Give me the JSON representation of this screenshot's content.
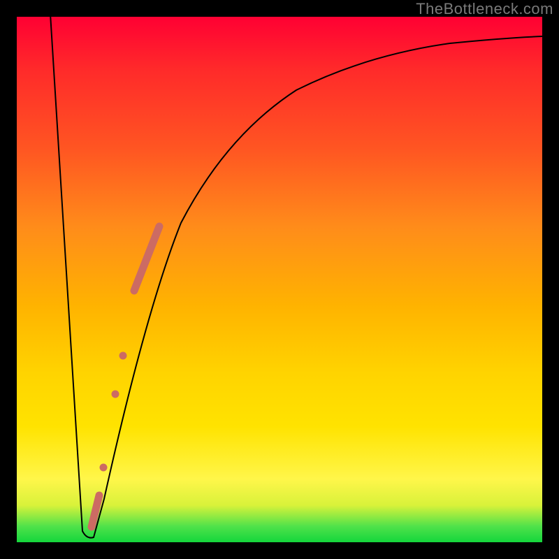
{
  "watermark": "TheBottleneck.com",
  "colors": {
    "background_frame": "#000000",
    "curve": "#000000",
    "marker": "#cc6b63",
    "gradient_top": "#ff0033",
    "gradient_bottom": "#14d63c"
  },
  "chart_data": {
    "type": "line",
    "title": "",
    "xlabel": "",
    "ylabel": "",
    "xlim": [
      0,
      100
    ],
    "ylim": [
      0,
      100
    ],
    "grid": false,
    "background": "red-to-green vertical gradient (bottleneck severity)",
    "series": [
      {
        "name": "bottleneck-curve",
        "x": [
          0,
          3,
          6,
          9,
          11,
          12.5,
          14,
          16,
          18,
          21,
          24,
          27,
          30,
          34,
          38,
          43,
          48,
          54,
          60,
          67,
          74,
          82,
          90,
          100
        ],
        "y": [
          122,
          95,
          68,
          40,
          15,
          3,
          2,
          12,
          25,
          40,
          52,
          60,
          67,
          73,
          78,
          82,
          85,
          88,
          90,
          92,
          93.5,
          94.5,
          95.3,
          96
        ]
      }
    ],
    "markers": [
      {
        "kind": "thick_segment",
        "x_range": [
          22.5,
          27.0
        ],
        "y_range": [
          48,
          60
        ]
      },
      {
        "kind": "dot",
        "x": 20.0,
        "y": 35
      },
      {
        "kind": "dot",
        "x": 18.5,
        "y": 28
      },
      {
        "kind": "dot",
        "x": 16.3,
        "y": 14
      },
      {
        "kind": "short_segment",
        "x_range": [
          14.2,
          15.5
        ],
        "y_range": [
          3,
          9
        ]
      }
    ],
    "note": "y values are bottleneck % (0 = no bottleneck / green floor, 100 = top of plot). x is relative component scale. Curve dips to ~2% near x≈13 then asymptotically rises toward ~96%."
  }
}
